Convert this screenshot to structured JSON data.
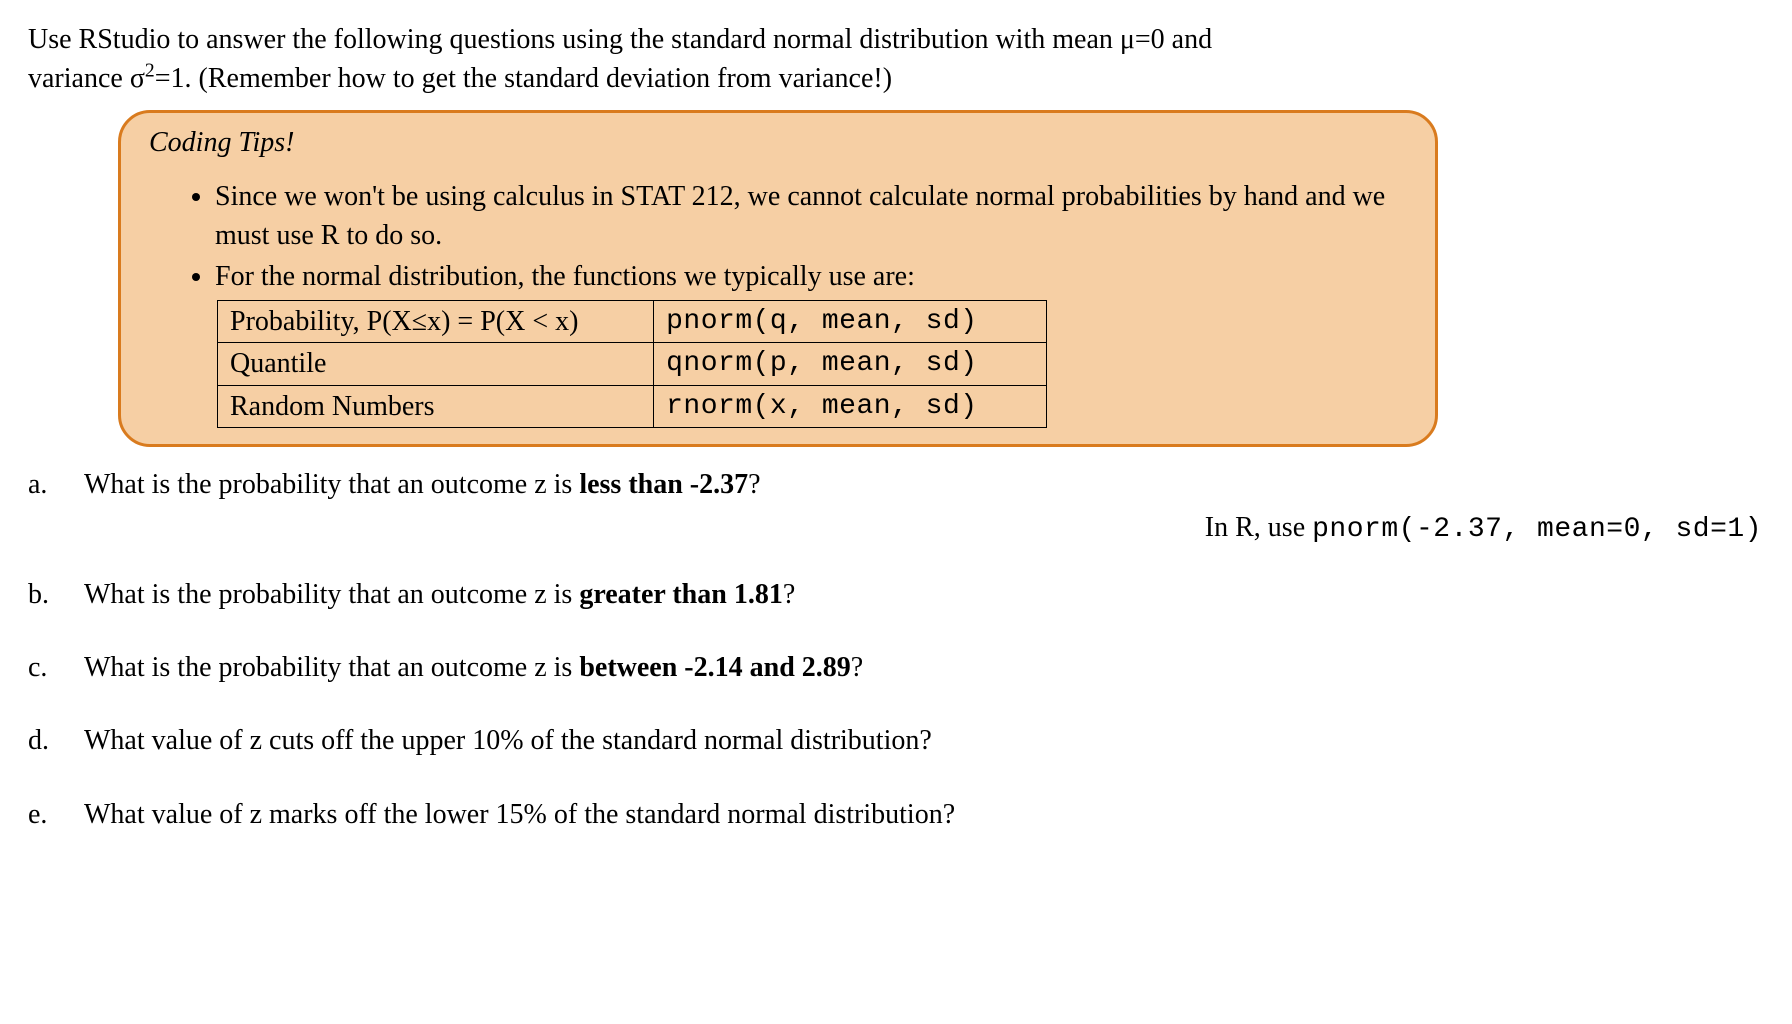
{
  "intro": {
    "line1_pre": "Use RStudio to answer the following questions using the standard normal distribution with mean μ=0 and",
    "line2_pre": "variance σ",
    "line2_sup": "2",
    "line2_post": "=1. (Remember how to get the standard deviation from variance!)"
  },
  "tips": {
    "title": "Coding Tips!",
    "bullet1": "Since we won't be using calculus in STAT 212, we cannot calculate normal probabilities by hand and we must use R to do so.",
    "bullet2": "For the normal distribution, the functions we typically use are:",
    "table": [
      {
        "desc": "Probability, P(X≤x) = P(X < x)",
        "code": "pnorm(q, mean, sd)"
      },
      {
        "desc": "Quantile",
        "code": "qnorm(p, mean, sd)"
      },
      {
        "desc": "Random Numbers",
        "code": "rnorm(x, mean, sd)"
      }
    ]
  },
  "questions": {
    "a": {
      "letter": "a.",
      "pre": "What is the probability that an outcome z is ",
      "bold": "less than -2.37",
      "post": "?"
    },
    "b": {
      "letter": "b.",
      "pre": "What is the probability that an outcome z is ",
      "bold": "greater than 1.81",
      "post": "?"
    },
    "c": {
      "letter": "c.",
      "pre": "What is the probability that an outcome z is ",
      "bold": "between -2.14 and 2.89",
      "post": "?"
    },
    "d": {
      "letter": "d.",
      "text": "What value of z cuts off the upper 10% of the standard normal distribution?"
    },
    "e": {
      "letter": "e.",
      "text": "What value of z marks off the lower 15% of the standard normal distribution?"
    }
  },
  "r_hint": {
    "pre": "In R, use ",
    "code": "pnorm(-2.37, mean=0, sd=1)"
  }
}
